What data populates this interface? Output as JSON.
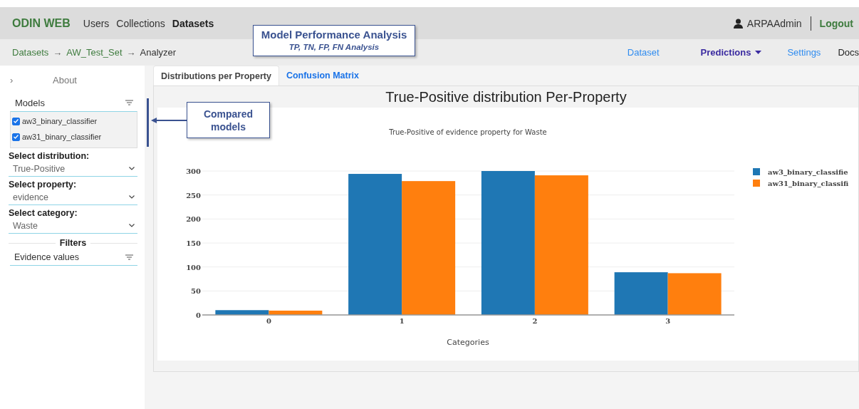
{
  "navbar": {
    "brand": "ODIN WEB",
    "links": [
      {
        "label": "Users",
        "selected": false
      },
      {
        "label": "Collections",
        "selected": false
      },
      {
        "label": "Datasets",
        "selected": true
      }
    ],
    "user": "ARPAAdmin",
    "logout": "Logout"
  },
  "breadcrumb": {
    "items": [
      "Datasets",
      "AW_Test_Set",
      "Analyzer"
    ],
    "separator": "→"
  },
  "subnav": [
    {
      "label": "Dataset",
      "kind": "link",
      "selected": false
    },
    {
      "label": "Predictions",
      "kind": "dropdown",
      "selected": true
    },
    {
      "label": "Settings",
      "kind": "link",
      "selected": false
    },
    {
      "label": "Docs",
      "kind": "plain",
      "selected": false
    }
  ],
  "sidebar": {
    "toggle": "›",
    "about": "About",
    "models": {
      "title": "Models",
      "items": [
        {
          "label": "aw3_binary_classifier",
          "checked": true
        },
        {
          "label": "aw31_binary_classifier",
          "checked": true
        }
      ]
    },
    "selects": [
      {
        "label": "Select distribution:",
        "value": "True-Positive"
      },
      {
        "label": "Select property:",
        "value": "evidence"
      },
      {
        "label": "Select category:",
        "value": "Waste"
      }
    ],
    "filters": {
      "title": "Filters",
      "field": "Evidence values"
    }
  },
  "tabs": [
    {
      "label": "Distributions per Property",
      "selected": true
    },
    {
      "label": "Confusion Matrix",
      "selected": false
    }
  ],
  "panel": {
    "title": "True-Positive distribution Per-Property",
    "chart_data": {
      "type": "bar",
      "title": "True-Positive of evidence property for Waste",
      "xlabel": "Categories",
      "categories": [
        "0",
        "1",
        "2",
        "3"
      ],
      "series": [
        {
          "name": "aw3_binary_classifie",
          "color": "#1f77b4",
          "values": [
            10,
            294,
            300,
            89
          ]
        },
        {
          "name": "aw31_binary_classifi",
          "color": "#ff7f0e",
          "values": [
            9,
            279,
            291,
            87
          ]
        }
      ],
      "grid": true,
      "legend": true,
      "ylim": [
        0,
        300
      ],
      "yticks": [
        0,
        50,
        100,
        150,
        200,
        250,
        300
      ]
    }
  },
  "annotations": [
    {
      "title": "Model Performance Analysis",
      "subtitle": "TP, TN, FP, FN Analysis"
    },
    {
      "title": "Compared models"
    }
  ]
}
